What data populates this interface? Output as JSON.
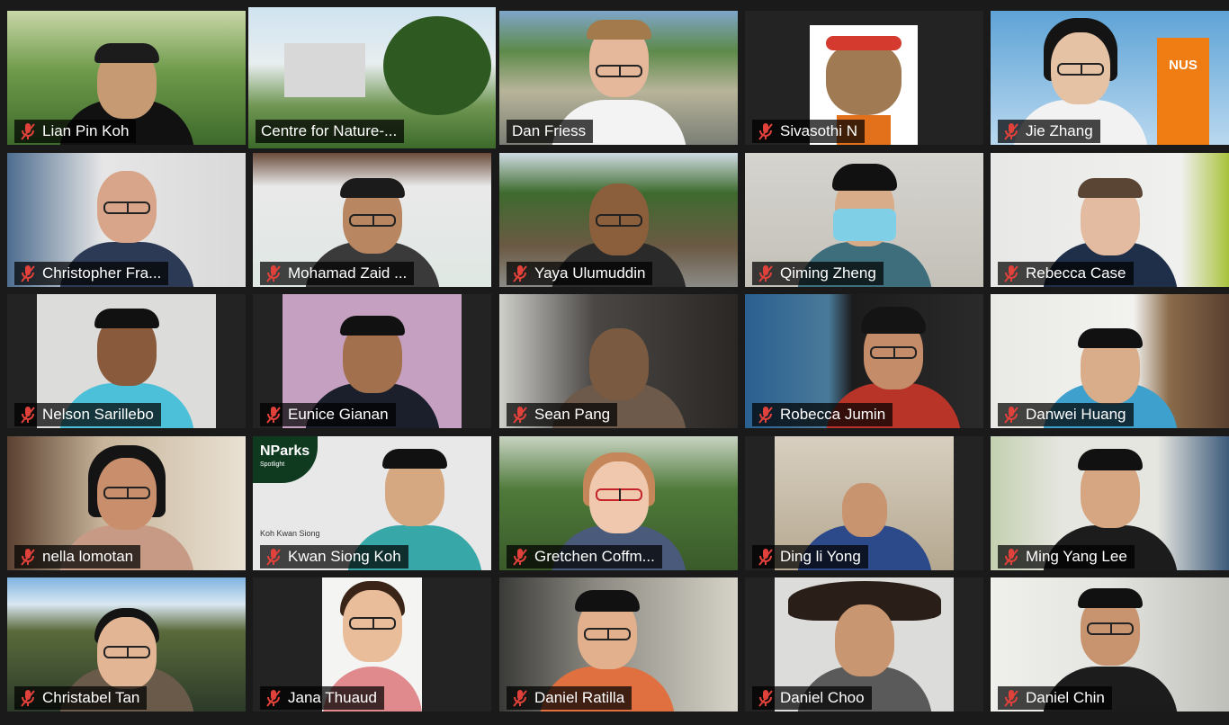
{
  "participants": [
    {
      "name": "Lian Pin Koh",
      "muted": true
    },
    {
      "name": "Centre for Nature-...",
      "muted": false,
      "active_speaker": true
    },
    {
      "name": "Dan Friess",
      "muted": false
    },
    {
      "name": "Sivasothi N",
      "muted": true
    },
    {
      "name": "Jie Zhang",
      "muted": true
    },
    {
      "name": "Christopher Fra...",
      "muted": true
    },
    {
      "name": "Mohamad Zaid ...",
      "muted": true
    },
    {
      "name": "Yaya Ulumuddin",
      "muted": true
    },
    {
      "name": "Qiming Zheng",
      "muted": true
    },
    {
      "name": "Rebecca Case",
      "muted": true
    },
    {
      "name": "Nelson Sarillebo",
      "muted": true
    },
    {
      "name": "Eunice Gianan",
      "muted": true
    },
    {
      "name": "Sean Pang",
      "muted": true
    },
    {
      "name": "Robecca Jumin",
      "muted": true
    },
    {
      "name": "Danwei Huang",
      "muted": true
    },
    {
      "name": "nella lomotan",
      "muted": true
    },
    {
      "name": "Kwan Siong Koh",
      "muted": true
    },
    {
      "name": "Gretchen Coffm...",
      "muted": true
    },
    {
      "name": "Ding li Yong",
      "muted": true
    },
    {
      "name": "Ming Yang Lee",
      "muted": true
    },
    {
      "name": "Christabel Tan",
      "muted": true
    },
    {
      "name": "Jana Thuaud",
      "muted": true
    },
    {
      "name": "Daniel Ratilla",
      "muted": true
    },
    {
      "name": "Daniel Choo",
      "muted": true
    },
    {
      "name": "Daniel Chin",
      "muted": true
    }
  ],
  "overlays": {
    "nparks_logo": "NParks",
    "nparks_sub": "Spotlight",
    "kwan_caption": "Koh Kwan Siong",
    "nus_sign": "NUS"
  },
  "colors": {
    "background": "#1a1a1a",
    "active_speaker_border": "#b8df3a",
    "mute_icon": "#e0413a"
  }
}
